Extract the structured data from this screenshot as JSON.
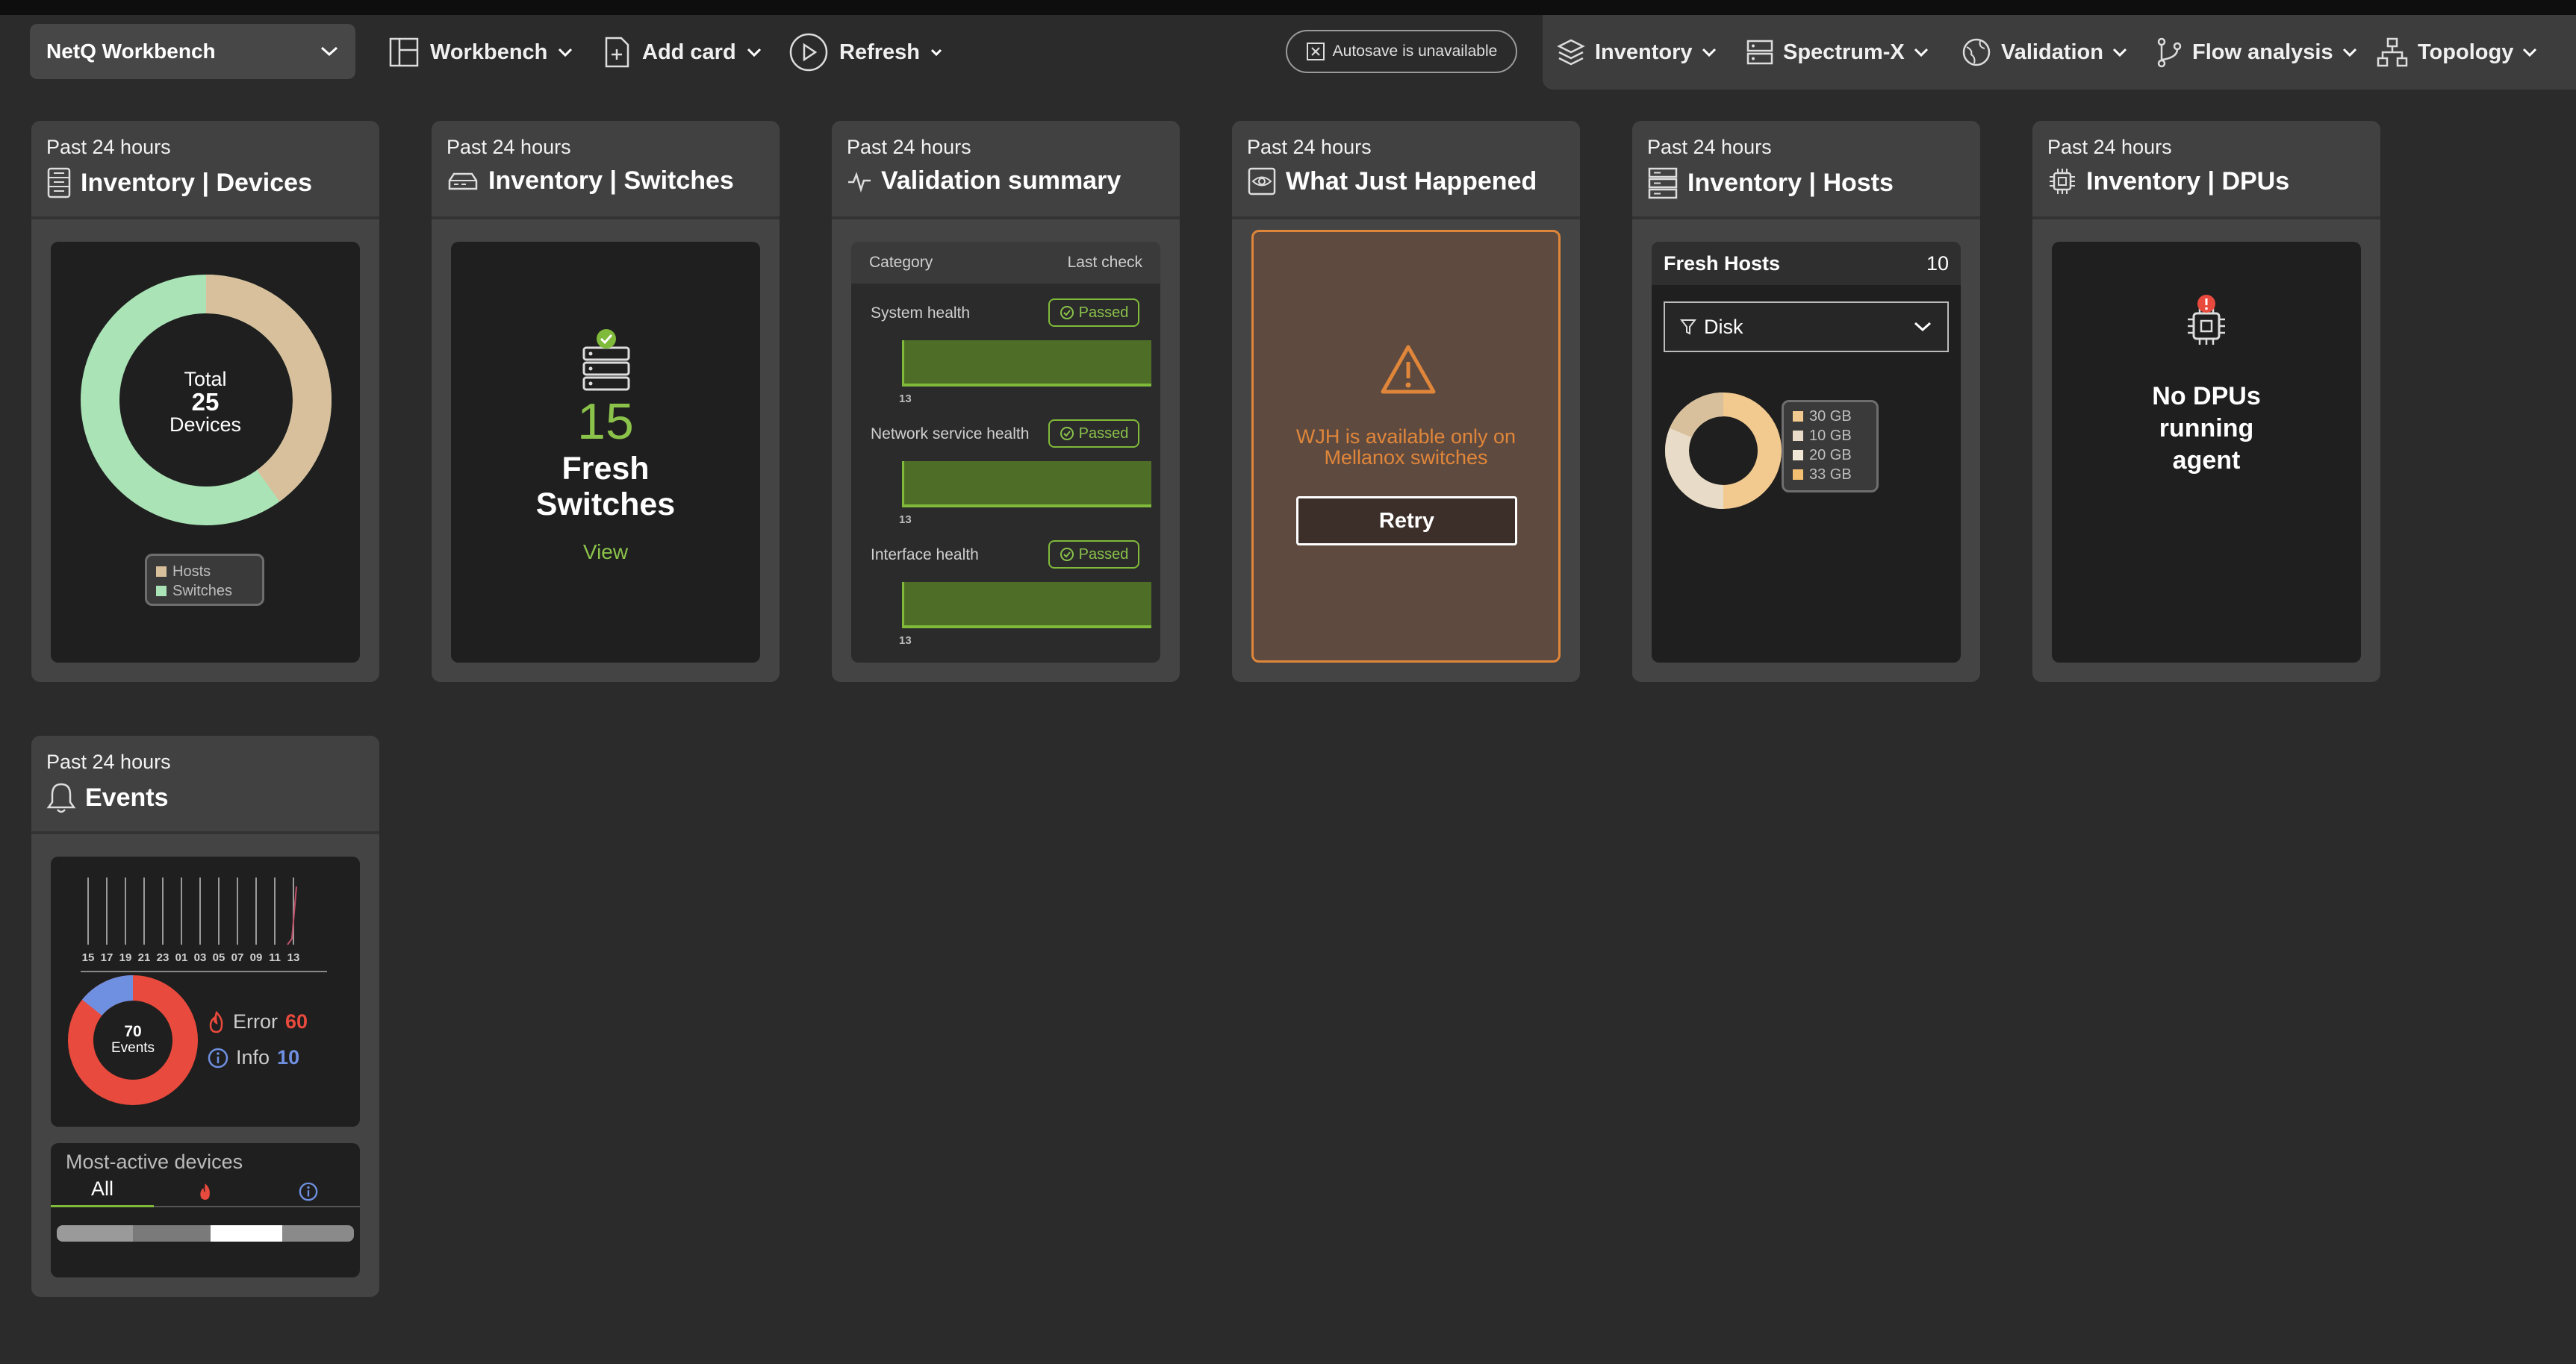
{
  "toolbar": {
    "workspace": "NetQ Workbench",
    "workbench_label": "Workbench",
    "add_card_label": "Add card",
    "refresh_label": "Refresh",
    "autosave_label": "Autosave is unavailable",
    "nav": [
      {
        "label": "Inventory"
      },
      {
        "label": "Spectrum-X"
      },
      {
        "label": "Validation"
      },
      {
        "label": "Flow analysis"
      },
      {
        "label": "Topology"
      }
    ]
  },
  "colors": {
    "background": "#2b2b2b",
    "card": "#444444",
    "accent_green": "#7fba3a",
    "error_red": "#e84a3d",
    "info_blue": "#6f8fe0",
    "wjh_orange": "#e0863a",
    "hosts_tan": "#d8c09c",
    "switches_green": "#a9e3b6"
  },
  "cards": {
    "devices": {
      "period": "Past 24 hours",
      "title": "Inventory | Devices",
      "total_label": "Total",
      "total_value": "25",
      "total_unit": "Devices",
      "legend": [
        "Hosts",
        "Switches"
      ],
      "hosts_count": 10,
      "switches_count": 15
    },
    "switches": {
      "period": "Past 24 hours",
      "title": "Inventory | Switches",
      "count": "15",
      "label_line1": "Fresh",
      "label_line2": "Switches",
      "view_link": "View"
    },
    "validation": {
      "period": "Past 24 hours",
      "title": "Validation summary",
      "col_category": "Category",
      "col_last_check": "Last check",
      "rows": [
        {
          "name": "System health",
          "status": "Passed",
          "tick": "13"
        },
        {
          "name": "Network service health",
          "status": "Passed",
          "tick": "13"
        },
        {
          "name": "Interface health",
          "status": "Passed",
          "tick": "13"
        }
      ]
    },
    "wjh": {
      "period": "Past 24 hours",
      "title": "What Just Happened",
      "message_line1": "WJH is available only on",
      "message_line2": "Mellanox switches",
      "retry_label": "Retry"
    },
    "hosts": {
      "period": "Past 24 hours",
      "title": "Inventory | Hosts",
      "fresh_label": "Fresh Hosts",
      "fresh_count": "10",
      "filter_value": "Disk",
      "legend": [
        "30 GB",
        "10 GB",
        "20 GB",
        "33 GB"
      ]
    },
    "dpus": {
      "period": "Past 24 hours",
      "title": "Inventory | DPUs",
      "message_line1": "No DPUs",
      "message_line2": "running",
      "message_line3": "agent"
    },
    "events": {
      "period": "Past 24 hours",
      "title": "Events",
      "timeline_ticks": [
        "15",
        "17",
        "19",
        "21",
        "23",
        "01",
        "03",
        "05",
        "07",
        "09",
        "11",
        "13"
      ],
      "total_value": "70",
      "total_label": "Events",
      "error_label": "Error",
      "error_count": "60",
      "info_label": "Info",
      "info_count": "10",
      "most_active_label": "Most-active devices",
      "tab_all": "All"
    }
  }
}
